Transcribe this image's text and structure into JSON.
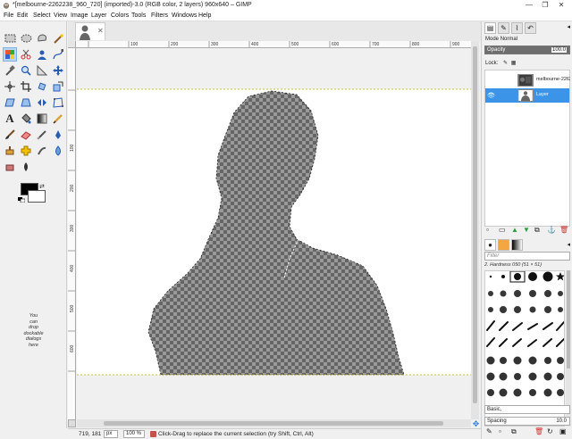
{
  "window": {
    "title": "*[melbourne-2262238_960_720] (imported)-3.0 (RGB color, 2 layers) 960x640 – GIMP",
    "minimize_glyph": "—",
    "restore_glyph": "❐",
    "close_glyph": "✕"
  },
  "menu": [
    "File",
    "Edit",
    "Select",
    "View",
    "Image",
    "Layer",
    "Colors",
    "Tools",
    "Filters",
    "Windows",
    "Help"
  ],
  "toolbox": {
    "drop_hint": [
      "You",
      "can",
      "drop",
      "dockable",
      "dialogs",
      "here"
    ],
    "foreground_color": "#000000",
    "background_color": "#ffffff"
  },
  "image_tab": {
    "close_glyph": "✕"
  },
  "rulers": {
    "horizontal_labels": [
      "100",
      "200",
      "300",
      "400",
      "500",
      "600",
      "700",
      "800",
      "900"
    ],
    "vertical_labels": [
      "100",
      "200",
      "300",
      "400",
      "500",
      "600"
    ]
  },
  "status_bar": {
    "coordinates": "719, 181",
    "unit": "px",
    "zoom": "100 %",
    "message": "Click-Drag to replace the current selection (try Shift, Ctrl, Alt)"
  },
  "layers_panel": {
    "mode_label": "Mode",
    "mode_value": "Normal",
    "opacity_label": "Opacity",
    "opacity_value": "100.0",
    "lock_label": "Lock:",
    "layers": [
      {
        "name": "melbourne-2262",
        "selected": false,
        "visible": false
      },
      {
        "name": "Layer",
        "selected": true,
        "visible": true
      }
    ]
  },
  "brushes_panel": {
    "filter_placeholder": "Filter",
    "current_brush": "2. Hardness 050 (51 × 51)",
    "tag": "Basic,",
    "spacing_label": "Spacing",
    "spacing_value": "10.0"
  },
  "colors": {
    "accent": "#3b94e8",
    "selection_guide": "#cccc00",
    "canvas_white": "#ffffff",
    "checker_dark": "#666666",
    "checker_light": "#999999"
  }
}
